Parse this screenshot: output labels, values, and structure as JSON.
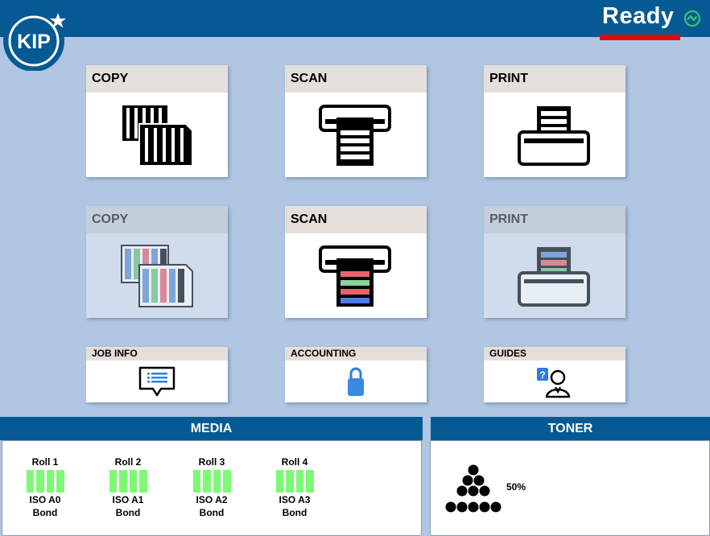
{
  "header": {
    "logo_text": "KIP",
    "status": "Ready",
    "status_underline_color": "#e10a0a",
    "status_icon": "ready-status-icon"
  },
  "tiles": {
    "copy_bw": {
      "label": "COPY",
      "icon": "copy-documents-icon",
      "enabled": true
    },
    "scan_bw": {
      "label": "SCAN",
      "icon": "scanner-icon",
      "enabled": true
    },
    "print_bw": {
      "label": "PRINT",
      "icon": "printer-icon",
      "enabled": true
    },
    "copy_color": {
      "label": "COPY",
      "icon": "copy-color-documents-icon",
      "enabled": false
    },
    "scan_color": {
      "label": "SCAN",
      "icon": "scanner-color-icon",
      "enabled": true
    },
    "print_color": {
      "label": "PRINT",
      "icon": "printer-color-icon",
      "enabled": false
    },
    "job_info": {
      "label": "JOB INFO",
      "icon": "job-info-icon"
    },
    "accounting": {
      "label": "ACCOUNTING",
      "icon": "lock-icon"
    },
    "guides": {
      "label": "GUIDES",
      "icon": "help-person-icon"
    }
  },
  "media": {
    "title": "MEDIA",
    "rolls": [
      {
        "name": "Roll 1",
        "size": "ISO A0",
        "type": "Bond",
        "level": 1.0
      },
      {
        "name": "Roll 2",
        "size": "ISO A1",
        "type": "Bond",
        "level": 1.0
      },
      {
        "name": "Roll 3",
        "size": "ISO A2",
        "type": "Bond",
        "level": 1.0
      },
      {
        "name": "Roll 4",
        "size": "ISO A3",
        "type": "Bond",
        "level": 1.0
      }
    ],
    "level_color": "#7dfa74"
  },
  "toner": {
    "title": "TONER",
    "level": "50%"
  },
  "colors": {
    "background": "#b0c6e2",
    "header_blue": "#065a94",
    "tile_header": "#e5dfdb"
  }
}
